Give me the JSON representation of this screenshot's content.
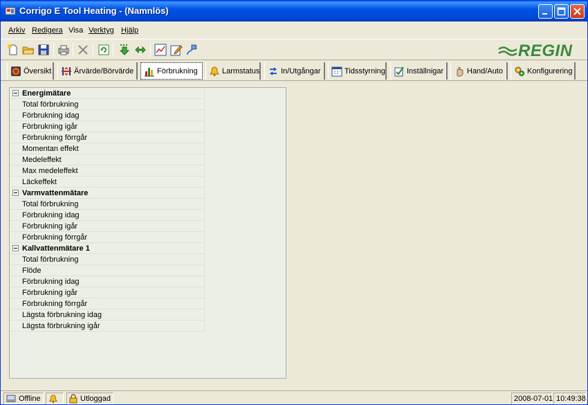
{
  "window": {
    "title": "Corrigo E Tool Heating - (Namnlös)"
  },
  "menu": [
    {
      "label": "Arkiv"
    },
    {
      "label": "Redigera"
    },
    {
      "label": "Visa"
    },
    {
      "label": "Verktyg"
    },
    {
      "label": "Hjälp"
    }
  ],
  "logo": {
    "text": "REGIN",
    "color": "#3A8A3E"
  },
  "tabs": [
    {
      "label": "Översikt",
      "icon": "overview-icon"
    },
    {
      "label": "Ärvärde/Börvärde",
      "icon": "setpoint-icon"
    },
    {
      "label": "Förbrukning",
      "icon": "consumption-chart-icon",
      "active": true
    },
    {
      "label": "Larmstatus",
      "icon": "alarm-bell-icon"
    },
    {
      "label": "In/Utgångar",
      "icon": "io-arrows-icon"
    },
    {
      "label": "Tidsstyrning",
      "icon": "calendar-icon"
    },
    {
      "label": "Inställnigar",
      "icon": "settings-check-icon"
    },
    {
      "label": "Hand/Auto",
      "icon": "hand-icon"
    },
    {
      "label": "Konfigurering",
      "icon": "configure-icon"
    }
  ],
  "tree": [
    {
      "group": "Energimätare",
      "items": [
        "Total förbrukning",
        "Förbrukning idag",
        "Förbrukning igår",
        "Förbrukning förrgår",
        "Momentan effekt",
        "Medeleffekt",
        "Max medeleffekt",
        "Läckeffekt"
      ]
    },
    {
      "group": "Varmvattenmätare",
      "items": [
        "Total förbrukning",
        "Förbrukning idag",
        "Förbrukning igår",
        "Förbrukning förrgår"
      ]
    },
    {
      "group": "Kallvattenmätare 1",
      "items": [
        "Total förbrukning",
        "Flöde",
        "Förbrukning idag",
        "Förbrukning igår",
        "Förbrukning förrgår",
        "Lägsta förbrukning idag",
        "Lägsta förbrukning igår"
      ]
    }
  ],
  "status": {
    "connection": "Offline",
    "login": "Utloggad",
    "date": "2008-07-01",
    "time": "10:49:38"
  }
}
